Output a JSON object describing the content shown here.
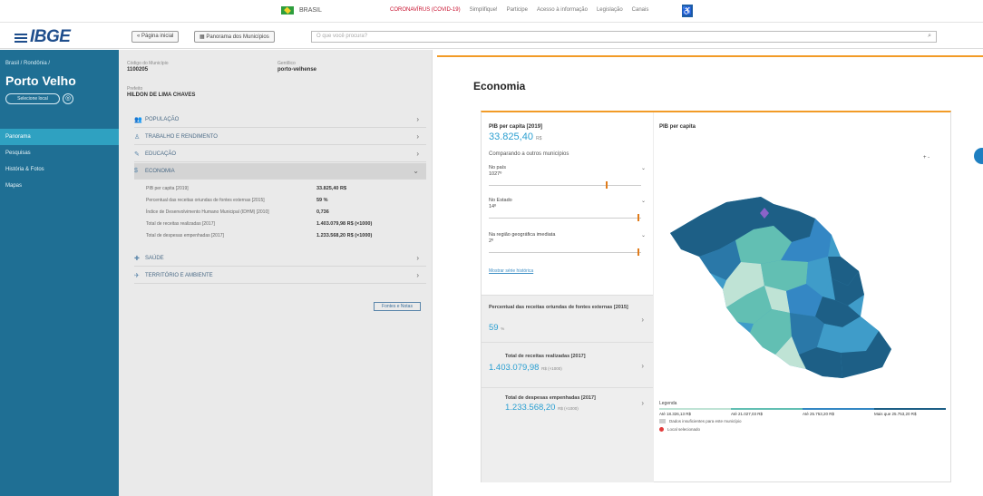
{
  "topbar": {
    "gov_label": "BRASIL",
    "links": [
      "CORONAVÍRUS (COVID-19)",
      "Simplifique!",
      "Participe",
      "Acesso à informação",
      "Legislação",
      "Canais"
    ],
    "accessibility_icon": "accessibility-icon"
  },
  "header": {
    "logo": "IBGE",
    "home_button": "« Página inicial",
    "mosaic_button": "Panorama dos Municípios",
    "search_placeholder": "O que você procura?"
  },
  "sidebar": {
    "breadcrumb": "Brasil / Rondônia /",
    "city": "Porto Velho",
    "select_button": "Selecione local",
    "nav": [
      {
        "label": "Panorama",
        "active": true
      },
      {
        "label": "Pesquisas",
        "active": false
      },
      {
        "label": "História & Fotos",
        "active": false
      },
      {
        "label": "Mapas",
        "active": false
      }
    ]
  },
  "municipio": {
    "code_label": "Código do Município",
    "code": "1100205",
    "gentilic_label": "Gentílico",
    "gentilic": "porto-velhense",
    "mayor_label": "Prefeito",
    "mayor": "HILDON DE LIMA CHAVES"
  },
  "sections": [
    {
      "label": "POPULAÇÃO",
      "icon": "people-icon"
    },
    {
      "label": "TRABALHO E RENDIMENTO",
      "icon": "worker-icon"
    },
    {
      "label": "EDUCAÇÃO",
      "icon": "education-icon"
    },
    {
      "label": "ECONOMIA",
      "icon": "economy-icon"
    },
    {
      "label": "SAÚDE",
      "icon": "health-icon"
    },
    {
      "label": "TERRITÓRIO E AMBIENTE",
      "icon": "territory-icon"
    }
  ],
  "economy_rows": [
    {
      "label": "PIB per capita [2019]",
      "value": "33.825,40 R$"
    },
    {
      "label": "Percentual das receitas oriundas de fontes externas [2015]",
      "value": "59 %"
    },
    {
      "label": "Índice de Desenvolvimento Humano Municipal (IDHM) [2010]",
      "value": "0,736"
    },
    {
      "label": "Total de receitas realizadas [2017]",
      "value": "1.403.079,98 R$ (×1000)"
    },
    {
      "label": "Total de despesas empenhadas [2017]",
      "value": "1.233.568,20 R$ (×1000)"
    }
  ],
  "source_link": "Fontes e Notas",
  "content": {
    "title": "Economia",
    "pib_title": "PIB per capita [2019]",
    "pib_value": "33.825,40",
    "pib_unit": "R$",
    "compare_label": "Comparando a outros municípios",
    "sliders": [
      {
        "label": "No país",
        "value": "1027º",
        "position": 0.78
      },
      {
        "label": "No Estado",
        "value": "14º",
        "position": 0.99
      },
      {
        "label": "Na região geográfica imediata",
        "value": "2º",
        "position": 0.99
      }
    ],
    "history_link": "Mostrar série histórica",
    "cards": [
      {
        "title": "Percentual das receitas oriundas de fontes externas [2015]",
        "value": "59",
        "unit": "%"
      },
      {
        "title": "Total de receitas realizadas [2017]",
        "value": "1.403.079,98",
        "unit": "R$ (×1000)"
      },
      {
        "title": "Total de despesas empenhadas [2017]",
        "value": "1.233.568,20",
        "unit": "R$ (×1000)"
      }
    ]
  },
  "map": {
    "title": "PIB per capita",
    "zoom_icons": "+  -",
    "legend_title": "Legenda",
    "legend_ranges": [
      "Até 18.326,13 R$",
      "Até 21.027,03 R$",
      "Até 25.753,20 R$",
      "Mais que 25.753,20 R$"
    ],
    "legend_colors": [
      "#bfe3d5",
      "#62bfb3",
      "#3487c4",
      "#1d5f86"
    ],
    "no_data_label": "Dados insuficientes para este município",
    "pin_label": "Local selecionado"
  }
}
